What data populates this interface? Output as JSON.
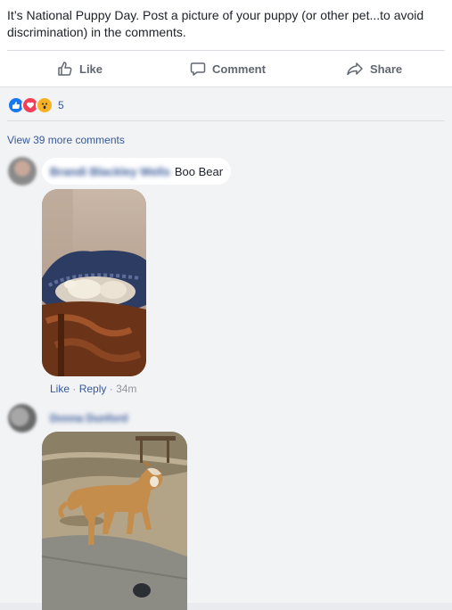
{
  "post": {
    "text": "It’s National Puppy Day. Post a picture of your puppy (or other pet...to avoid discrimination) in the comments."
  },
  "actions": {
    "like_label": "Like",
    "comment_label": "Comment",
    "share_label": "Share"
  },
  "reactions": {
    "types": [
      "like",
      "love",
      "wow"
    ],
    "count": "5"
  },
  "view_more_label": "View 39 more comments",
  "comments": [
    {
      "author": "Brandi Blackley Wells",
      "text": "Boo Bear",
      "like_label": "Like",
      "reply_label": "Reply",
      "time": "34m"
    },
    {
      "author": "Donna Dunford"
    }
  ],
  "colors": {
    "link": "#385898",
    "action_text": "#606770",
    "like_blue": "#1877f2",
    "love_red": "#f33e58",
    "wow_yellow": "#f7b125"
  },
  "icons": [
    "thumbs-up-icon",
    "comment-icon",
    "share-icon"
  ]
}
